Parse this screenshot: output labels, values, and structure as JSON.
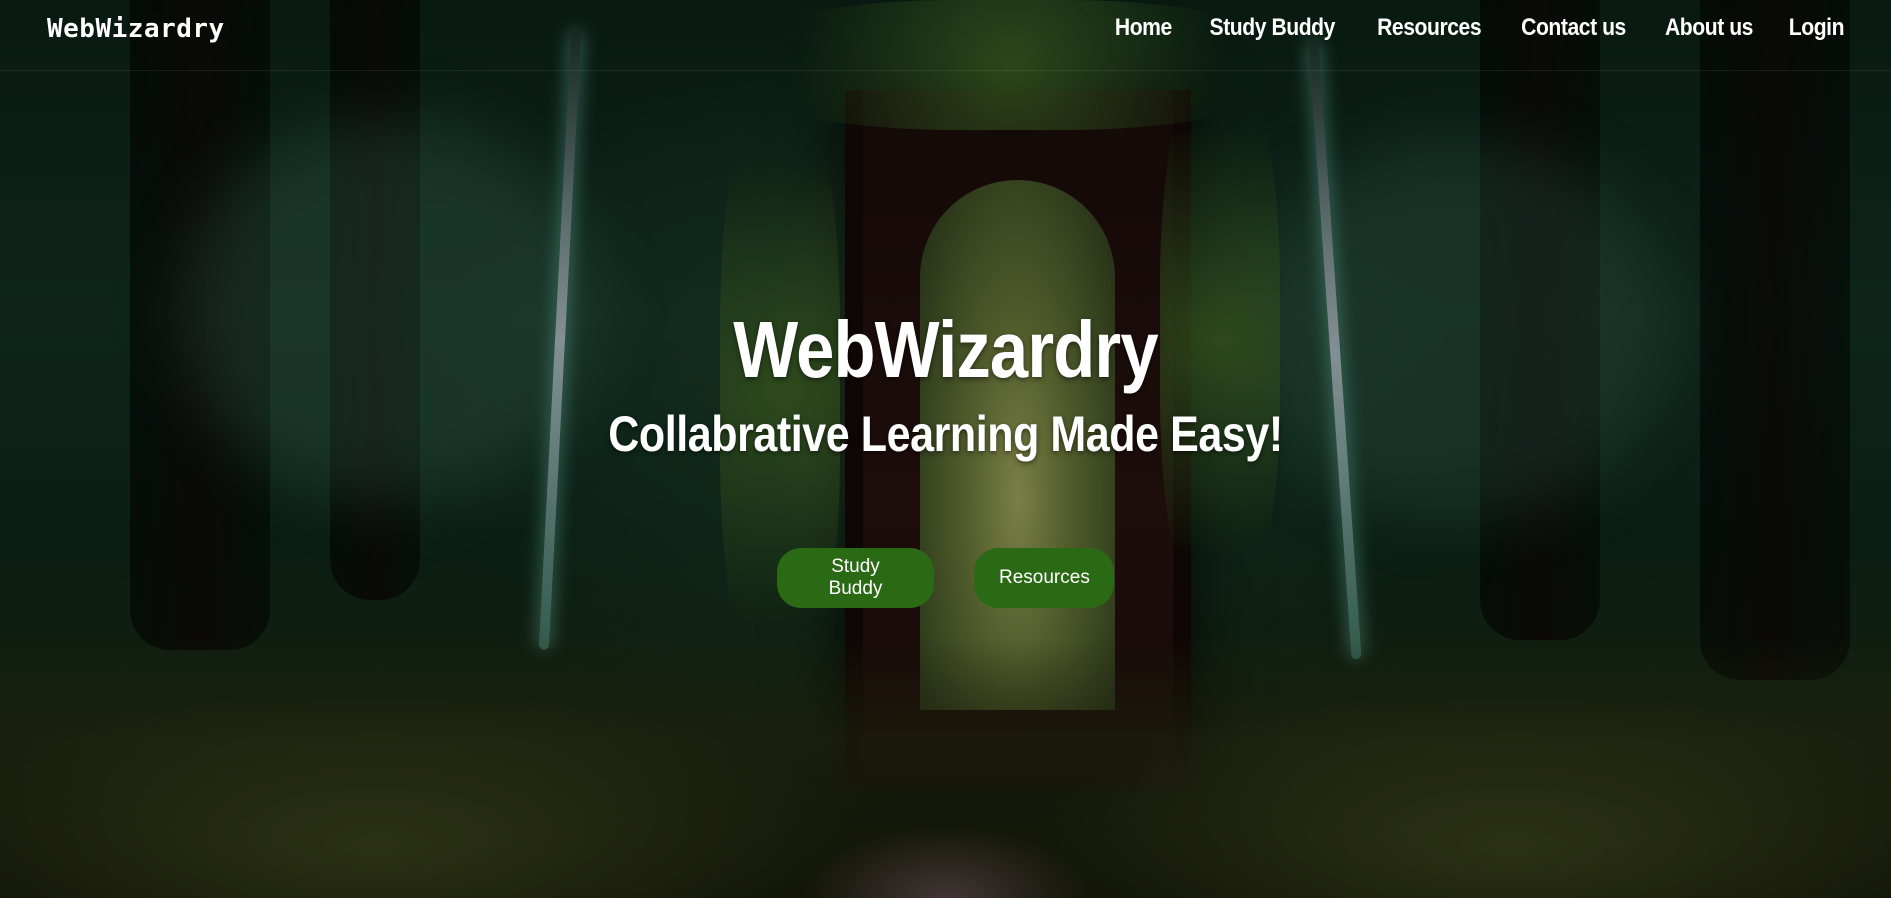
{
  "navbar": {
    "brand": "WebWizardry",
    "links": [
      "Home",
      "Study Buddy",
      "Resources",
      "Contact us",
      "About us",
      "Login"
    ]
  },
  "hero": {
    "title": "WebWizardry",
    "subtitle": "Collabrative Learning Made Easy!",
    "buttons": {
      "study_buddy": "Study Buddy",
      "resources": "Resources"
    },
    "background_image": "enchanted-forest-doorway"
  },
  "colors": {
    "button_green": "#2a6a14",
    "text": "#ffffff"
  }
}
